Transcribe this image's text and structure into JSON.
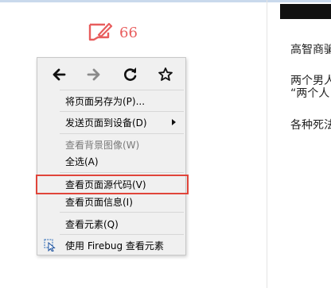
{
  "comment": {
    "count": "66",
    "icon": "comment-icon"
  },
  "article": {
    "lines": [
      "高智商骗",
      "两个男人",
      "“两个人",
      "各种死法"
    ]
  },
  "context_menu": {
    "nav": [
      {
        "name": "back-icon",
        "label": "Back"
      },
      {
        "name": "forward-icon",
        "label": "Forward"
      },
      {
        "name": "reload-icon",
        "label": "Reload"
      },
      {
        "name": "bookmark-star-icon",
        "label": "Bookmark"
      }
    ],
    "items": [
      {
        "label": "将页面另存为(P)...",
        "enabled": true,
        "submenu": false
      },
      {
        "label": "发送页面到设备(D)",
        "enabled": true,
        "submenu": true
      },
      {
        "label": "查看背景图像(W)",
        "enabled": false,
        "submenu": false
      },
      {
        "label": "全选(A)",
        "enabled": true,
        "submenu": false
      },
      {
        "label": "查看页面源代码(V)",
        "enabled": true,
        "submenu": false,
        "highlighted": true
      },
      {
        "label": "查看页面信息(I)",
        "enabled": true,
        "submenu": false
      },
      {
        "label": "查看元素(Q)",
        "enabled": true,
        "submenu": false
      },
      {
        "label": "使用 Firebug 查看元素",
        "enabled": true,
        "submenu": false,
        "icon": "firebug-inspect-icon"
      }
    ]
  },
  "colors": {
    "highlight_border": "#e0453a",
    "comment_accent": "#e85d5d"
  }
}
